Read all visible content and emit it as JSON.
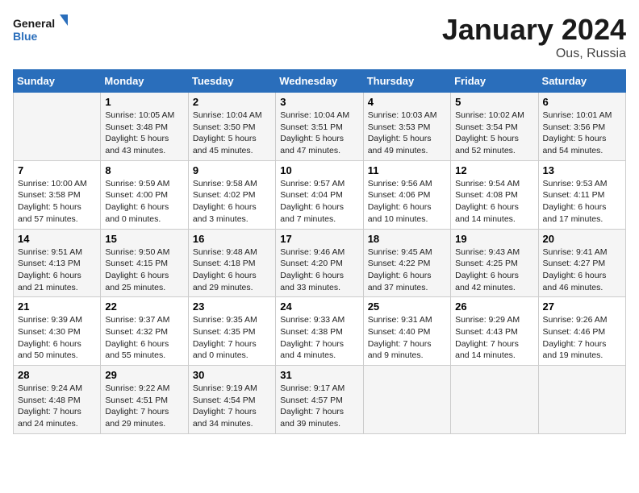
{
  "logo": {
    "line1": "General",
    "line2": "Blue"
  },
  "title": "January 2024",
  "location": "Ous, Russia",
  "weekdays": [
    "Sunday",
    "Monday",
    "Tuesday",
    "Wednesday",
    "Thursday",
    "Friday",
    "Saturday"
  ],
  "weeks": [
    [
      {
        "day": "",
        "sunrise": "",
        "sunset": "",
        "daylight": ""
      },
      {
        "day": "1",
        "sunrise": "Sunrise: 10:05 AM",
        "sunset": "Sunset: 3:48 PM",
        "daylight": "Daylight: 5 hours and 43 minutes."
      },
      {
        "day": "2",
        "sunrise": "Sunrise: 10:04 AM",
        "sunset": "Sunset: 3:50 PM",
        "daylight": "Daylight: 5 hours and 45 minutes."
      },
      {
        "day": "3",
        "sunrise": "Sunrise: 10:04 AM",
        "sunset": "Sunset: 3:51 PM",
        "daylight": "Daylight: 5 hours and 47 minutes."
      },
      {
        "day": "4",
        "sunrise": "Sunrise: 10:03 AM",
        "sunset": "Sunset: 3:53 PM",
        "daylight": "Daylight: 5 hours and 49 minutes."
      },
      {
        "day": "5",
        "sunrise": "Sunrise: 10:02 AM",
        "sunset": "Sunset: 3:54 PM",
        "daylight": "Daylight: 5 hours and 52 minutes."
      },
      {
        "day": "6",
        "sunrise": "Sunrise: 10:01 AM",
        "sunset": "Sunset: 3:56 PM",
        "daylight": "Daylight: 5 hours and 54 minutes."
      }
    ],
    [
      {
        "day": "7",
        "sunrise": "Sunrise: 10:00 AM",
        "sunset": "Sunset: 3:58 PM",
        "daylight": "Daylight: 5 hours and 57 minutes."
      },
      {
        "day": "8",
        "sunrise": "Sunrise: 9:59 AM",
        "sunset": "Sunset: 4:00 PM",
        "daylight": "Daylight: 6 hours and 0 minutes."
      },
      {
        "day": "9",
        "sunrise": "Sunrise: 9:58 AM",
        "sunset": "Sunset: 4:02 PM",
        "daylight": "Daylight: 6 hours and 3 minutes."
      },
      {
        "day": "10",
        "sunrise": "Sunrise: 9:57 AM",
        "sunset": "Sunset: 4:04 PM",
        "daylight": "Daylight: 6 hours and 7 minutes."
      },
      {
        "day": "11",
        "sunrise": "Sunrise: 9:56 AM",
        "sunset": "Sunset: 4:06 PM",
        "daylight": "Daylight: 6 hours and 10 minutes."
      },
      {
        "day": "12",
        "sunrise": "Sunrise: 9:54 AM",
        "sunset": "Sunset: 4:08 PM",
        "daylight": "Daylight: 6 hours and 14 minutes."
      },
      {
        "day": "13",
        "sunrise": "Sunrise: 9:53 AM",
        "sunset": "Sunset: 4:11 PM",
        "daylight": "Daylight: 6 hours and 17 minutes."
      }
    ],
    [
      {
        "day": "14",
        "sunrise": "Sunrise: 9:51 AM",
        "sunset": "Sunset: 4:13 PM",
        "daylight": "Daylight: 6 hours and 21 minutes."
      },
      {
        "day": "15",
        "sunrise": "Sunrise: 9:50 AM",
        "sunset": "Sunset: 4:15 PM",
        "daylight": "Daylight: 6 hours and 25 minutes."
      },
      {
        "day": "16",
        "sunrise": "Sunrise: 9:48 AM",
        "sunset": "Sunset: 4:18 PM",
        "daylight": "Daylight: 6 hours and 29 minutes."
      },
      {
        "day": "17",
        "sunrise": "Sunrise: 9:46 AM",
        "sunset": "Sunset: 4:20 PM",
        "daylight": "Daylight: 6 hours and 33 minutes."
      },
      {
        "day": "18",
        "sunrise": "Sunrise: 9:45 AM",
        "sunset": "Sunset: 4:22 PM",
        "daylight": "Daylight: 6 hours and 37 minutes."
      },
      {
        "day": "19",
        "sunrise": "Sunrise: 9:43 AM",
        "sunset": "Sunset: 4:25 PM",
        "daylight": "Daylight: 6 hours and 42 minutes."
      },
      {
        "day": "20",
        "sunrise": "Sunrise: 9:41 AM",
        "sunset": "Sunset: 4:27 PM",
        "daylight": "Daylight: 6 hours and 46 minutes."
      }
    ],
    [
      {
        "day": "21",
        "sunrise": "Sunrise: 9:39 AM",
        "sunset": "Sunset: 4:30 PM",
        "daylight": "Daylight: 6 hours and 50 minutes."
      },
      {
        "day": "22",
        "sunrise": "Sunrise: 9:37 AM",
        "sunset": "Sunset: 4:32 PM",
        "daylight": "Daylight: 6 hours and 55 minutes."
      },
      {
        "day": "23",
        "sunrise": "Sunrise: 9:35 AM",
        "sunset": "Sunset: 4:35 PM",
        "daylight": "Daylight: 7 hours and 0 minutes."
      },
      {
        "day": "24",
        "sunrise": "Sunrise: 9:33 AM",
        "sunset": "Sunset: 4:38 PM",
        "daylight": "Daylight: 7 hours and 4 minutes."
      },
      {
        "day": "25",
        "sunrise": "Sunrise: 9:31 AM",
        "sunset": "Sunset: 4:40 PM",
        "daylight": "Daylight: 7 hours and 9 minutes."
      },
      {
        "day": "26",
        "sunrise": "Sunrise: 9:29 AM",
        "sunset": "Sunset: 4:43 PM",
        "daylight": "Daylight: 7 hours and 14 minutes."
      },
      {
        "day": "27",
        "sunrise": "Sunrise: 9:26 AM",
        "sunset": "Sunset: 4:46 PM",
        "daylight": "Daylight: 7 hours and 19 minutes."
      }
    ],
    [
      {
        "day": "28",
        "sunrise": "Sunrise: 9:24 AM",
        "sunset": "Sunset: 4:48 PM",
        "daylight": "Daylight: 7 hours and 24 minutes."
      },
      {
        "day": "29",
        "sunrise": "Sunrise: 9:22 AM",
        "sunset": "Sunset: 4:51 PM",
        "daylight": "Daylight: 7 hours and 29 minutes."
      },
      {
        "day": "30",
        "sunrise": "Sunrise: 9:19 AM",
        "sunset": "Sunset: 4:54 PM",
        "daylight": "Daylight: 7 hours and 34 minutes."
      },
      {
        "day": "31",
        "sunrise": "Sunrise: 9:17 AM",
        "sunset": "Sunset: 4:57 PM",
        "daylight": "Daylight: 7 hours and 39 minutes."
      },
      {
        "day": "",
        "sunrise": "",
        "sunset": "",
        "daylight": ""
      },
      {
        "day": "",
        "sunrise": "",
        "sunset": "",
        "daylight": ""
      },
      {
        "day": "",
        "sunrise": "",
        "sunset": "",
        "daylight": ""
      }
    ]
  ]
}
